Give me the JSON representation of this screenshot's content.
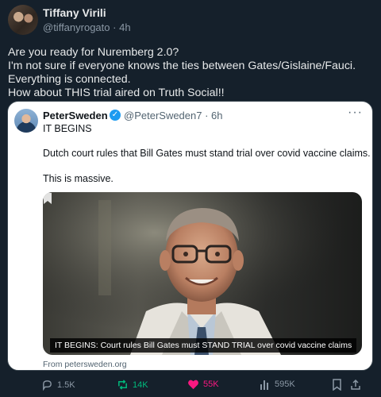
{
  "author": {
    "name": "Tiffany Virili",
    "handle": "@tiffanyrogato",
    "separator": "·",
    "time": "4h"
  },
  "post": {
    "lines": [
      "Are you ready for Nuremberg 2.0?",
      "I'm not sure if everyone knows the ties between Gates/Gislaine/Fauci.",
      "Everything is connected.",
      "How about THIS trial aired on Truth Social!!"
    ]
  },
  "quoted": {
    "name": "PeterSweden",
    "verified_mark": "✓",
    "handle": "@PeterSweden7 · 6h",
    "more": "···",
    "line1": "IT BEGINS",
    "line2": "Dutch court rules that Bill Gates must stand trial over covid vaccine claims.",
    "line3": "This is massive.",
    "media_caption": "IT BEGINS: Court rules Bill Gates must STAND TRIAL over covid vaccine claims",
    "from": "From petersweden.org"
  },
  "actions": {
    "replies": "1.5K",
    "reposts": "14K",
    "likes": "55K",
    "views": "595K"
  },
  "colors": {
    "background": "#15202b",
    "quote_background": "#ffffff",
    "repost": "#00ba7c",
    "like": "#f91880",
    "verified": "#1d9bf0"
  }
}
